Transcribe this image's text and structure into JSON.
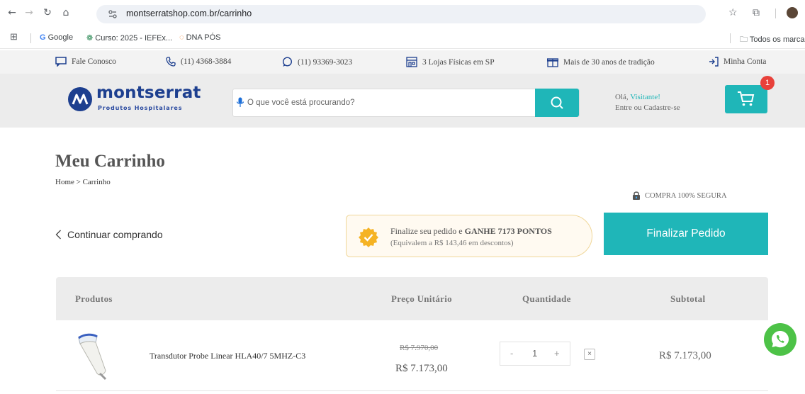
{
  "browser": {
    "url": "montserratshop.com.br/carrinho",
    "bookmarks": [
      "Google",
      "Curso: 2025 - IEFEx...",
      "DNA PÓS"
    ],
    "all_bookmarks": "Todos os marca"
  },
  "info_bar": {
    "contact": "Fale Conosco",
    "phone": "(11) 4368-3884",
    "whatsapp": "(11) 93369-3023",
    "stores": "3 Lojas Físicas em SP",
    "tradition": "Mais de 30 anos de tradição",
    "account": "Minha Conta"
  },
  "header": {
    "logo_name": "montserrat",
    "logo_sub": "Produtos Hospitalares",
    "search_placeholder": "O que você está procurando?",
    "greeting_prefix": "Olá, ",
    "greeting_name": "Visitante!",
    "greeting_line2": "Entre ou Cadastre-se",
    "cart_count": "1"
  },
  "page": {
    "title": "Meu Carrinho",
    "breadcrumb": "Home > Carrinho",
    "secure": "COMPRA 100% SEGURA",
    "continue": "Continuar comprando",
    "points_prefix": "Finalize seu pedido e ",
    "points_bold": "GANHE 7173 PONTOS",
    "points_line2": "(Equivalem a R$ 143,46 em descontos)",
    "finalize": "Finalizar Pedido"
  },
  "table": {
    "headers": [
      "Produtos",
      "Preço Unitário",
      "Quantidade",
      "Subtotal"
    ],
    "rows": [
      {
        "name": "Transdutor Probe Linear HLA40/7 5MHZ-C3",
        "old_price": "R$ 7.970,00",
        "price": "R$ 7.173,00",
        "qty_minus": "-",
        "qty": "1",
        "qty_plus": "+",
        "remove": "×",
        "subtotal": "R$ 7.173,00"
      }
    ]
  },
  "colors": {
    "accent": "#1fb6b8",
    "brand": "#1d3f8f",
    "badge": "#e8413a",
    "whatsapp": "#4dc247"
  }
}
